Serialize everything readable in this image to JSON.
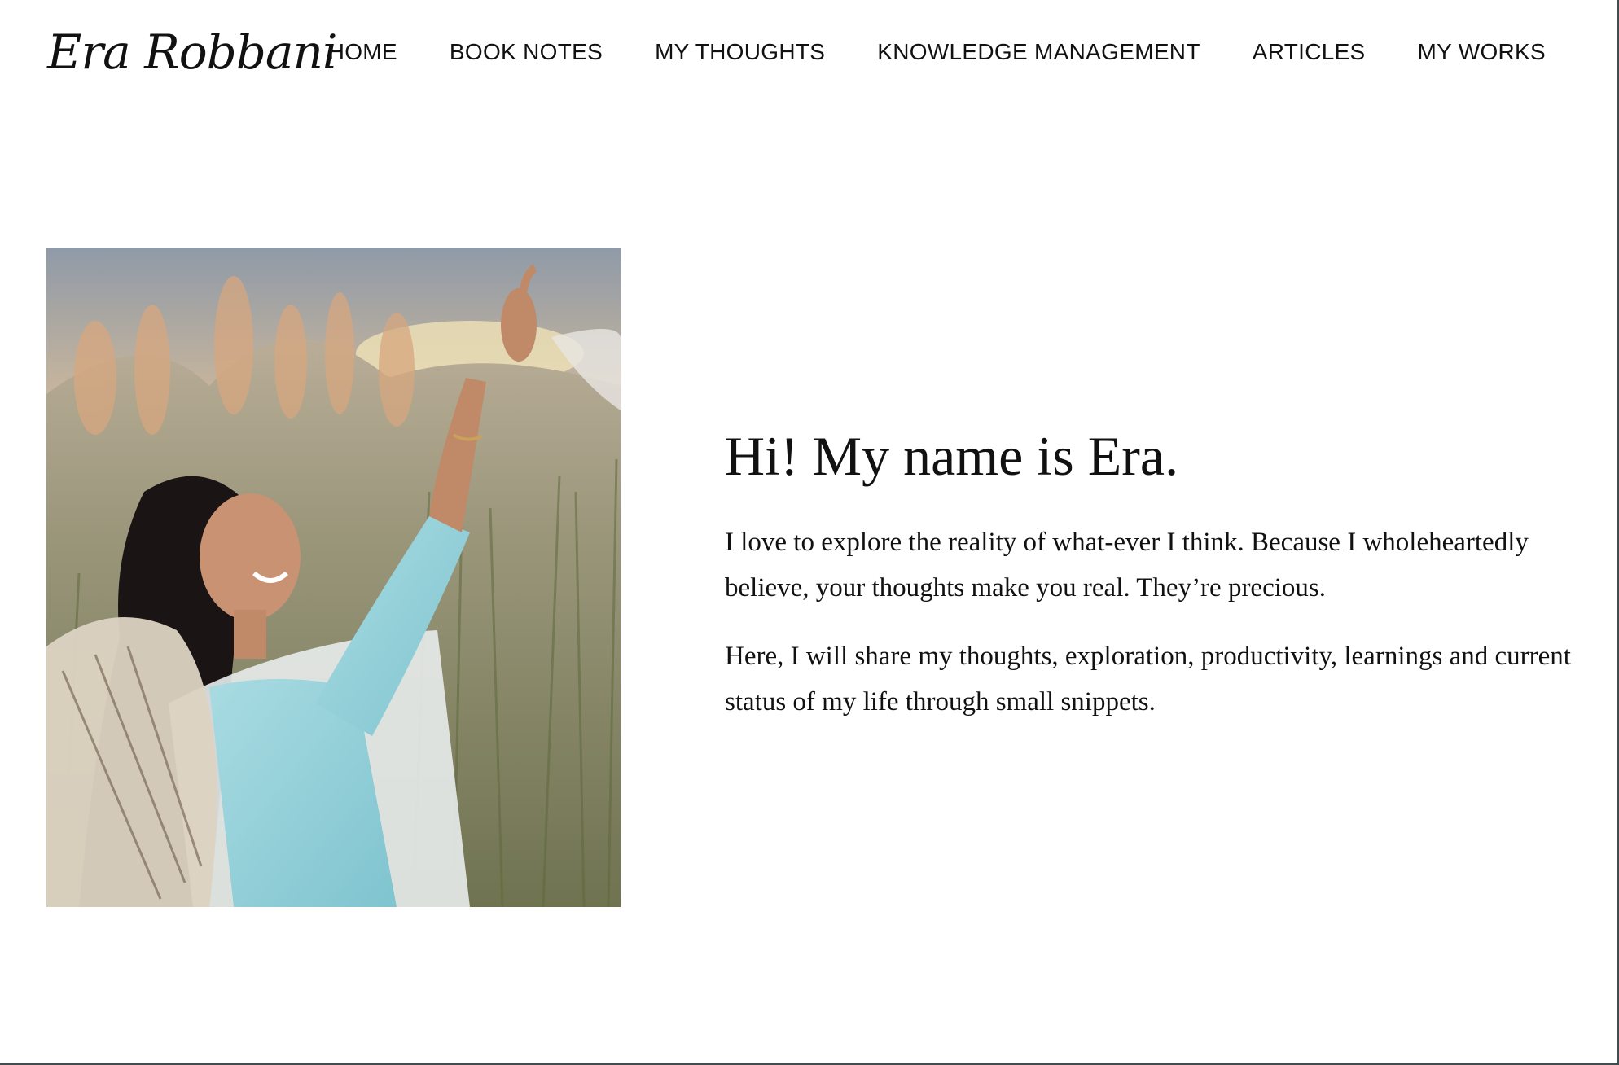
{
  "header": {
    "logo_text": "Era Robbani",
    "nav": [
      {
        "label": "HOME"
      },
      {
        "label": "BOOK NOTES"
      },
      {
        "label": "MY THOUGHTS"
      },
      {
        "label": "KNOWLEDGE MANAGEMENT"
      },
      {
        "label": "ARTICLES"
      },
      {
        "label": "MY WORKS"
      }
    ]
  },
  "hero": {
    "heading": "Hi! My name is Era.",
    "paragraphs": [
      "I love to explore the reality of what-ever I think. Because I wholeheartedly believe, your thoughts make you real. They’re precious.",
      "Here, I will share my thoughts, exploration, productivity, learnings and current status of my life through small snippets."
    ]
  },
  "colors": {
    "background": "#ffffff",
    "text": "#111111",
    "frame": "#3f4f4f"
  }
}
